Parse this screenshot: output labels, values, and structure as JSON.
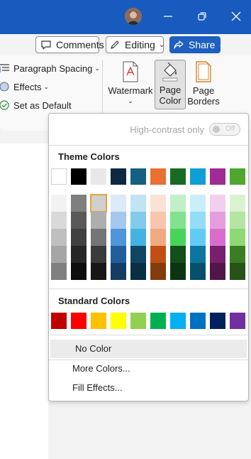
{
  "window": {
    "controls": [
      "minimize",
      "restore",
      "close"
    ],
    "title_bar_color": "#185abd"
  },
  "toolbar": {
    "comments_label": "Comments",
    "editing_label": "Editing",
    "share_label": "Share"
  },
  "ribbon": {
    "paragraph_spacing_label": "Paragraph Spacing",
    "effects_label": "Effects",
    "set_default_label": "Set as Default",
    "watermark_label": "Watermark",
    "page_color_label_1": "Page",
    "page_color_label_2": "Color",
    "page_borders_label_1": "Page",
    "page_borders_label_2": "Borders"
  },
  "page_color_menu": {
    "high_contrast_label": "High-contrast only",
    "high_contrast_state": "Off",
    "theme_colors_title": "Theme Colors",
    "theme_colors_top": [
      "#ffffff",
      "#000000",
      "#e8e8e8",
      "#0e2841",
      "#156082",
      "#e97132",
      "#196b24",
      "#0f9ed5",
      "#a02b93",
      "#4ea72e"
    ],
    "theme_colors_shades": [
      [
        "#f2f2f2",
        "#7f7f7f",
        "#d0d0d0",
        "#dceaf7",
        "#c1e4f5",
        "#fbe2d5",
        "#c1f0c8",
        "#caeefb",
        "#f2ceef",
        "#daf2d0"
      ],
      [
        "#d9d9d9",
        "#595959",
        "#aeaeae",
        "#a5c8ee",
        "#83cbeb",
        "#f7c6ac",
        "#83e28e",
        "#95dcf7",
        "#e59edd",
        "#b4e5a2"
      ],
      [
        "#bfbfbf",
        "#404040",
        "#757575",
        "#4e95d9",
        "#44b3e1",
        "#f1a983",
        "#47d45a",
        "#61cbf3",
        "#d86dcd",
        "#8ed973"
      ],
      [
        "#a6a6a6",
        "#262626",
        "#3a3a3a",
        "#215f9a",
        "#0f4761",
        "#c04f15",
        "#124f1a",
        "#0b76a0",
        "#782070",
        "#3b7d23"
      ],
      [
        "#808080",
        "#0d0d0d",
        "#171717",
        "#153d64",
        "#0a2f40",
        "#833c0c",
        "#0b3512",
        "#074f6a",
        "#501549",
        "#275317"
      ]
    ],
    "selected_theme_shade": "row 1, column 3",
    "standard_colors_title": "Standard Colors",
    "standard_colors": [
      "#c00000",
      "#ff0000",
      "#ffc000",
      "#ffff00",
      "#92d050",
      "#00b050",
      "#00b0f0",
      "#0070c0",
      "#002060",
      "#7030a0"
    ],
    "no_color_label": "No Color",
    "more_colors_label": "More Colors...",
    "fill_effects_label": "Fill Effects..."
  }
}
